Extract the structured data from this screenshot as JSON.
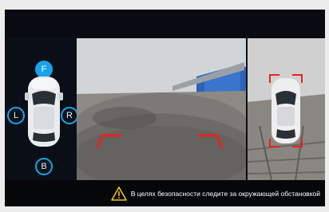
{
  "view_selector": {
    "front_label": "F",
    "left_label": "L",
    "right_label": "R",
    "back_label": "B",
    "active_view": "F"
  },
  "warning": {
    "icon": "warning-triangle-icon",
    "text": "В целях безопасности следите за окружающей обстановкой"
  },
  "colors": {
    "accent": "#1aa3e8",
    "guideline": "#e8231f",
    "warning_icon": "#f4c21b"
  }
}
